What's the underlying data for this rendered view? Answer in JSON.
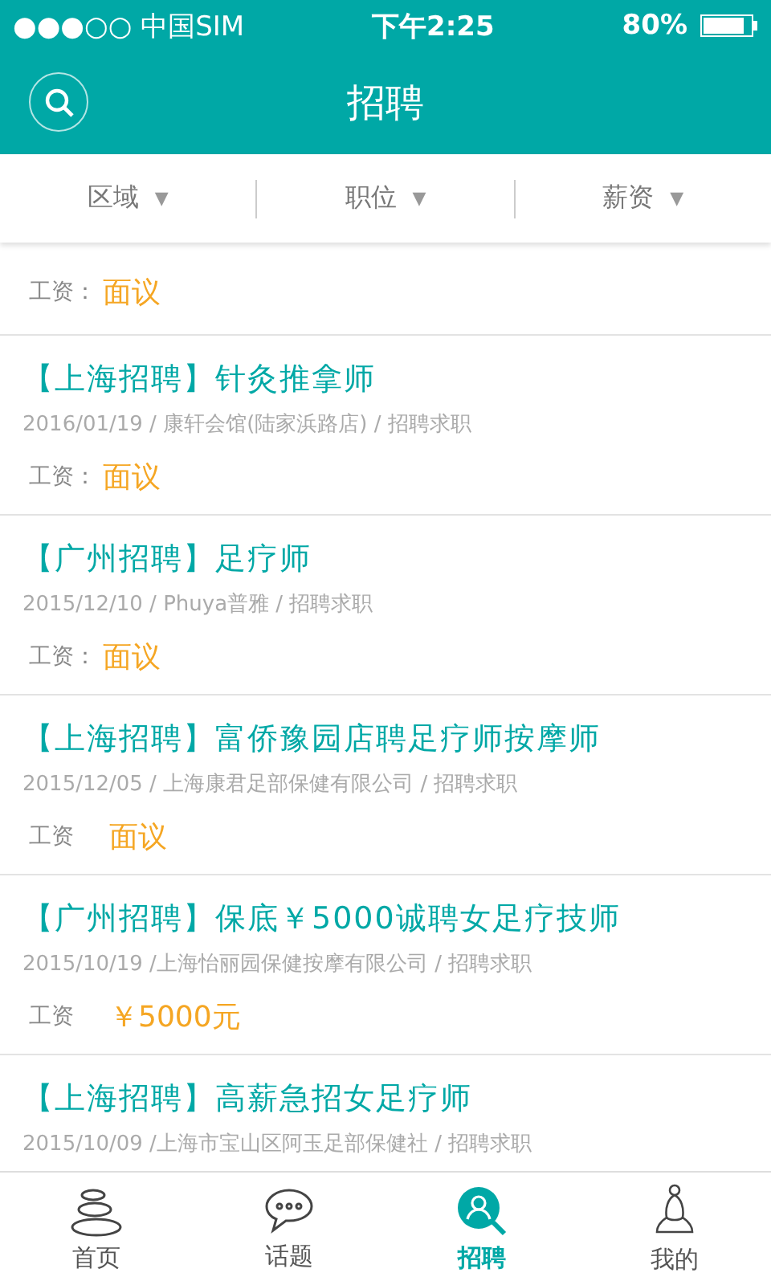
{
  "status_bar": {
    "carrier": "●●●○○ 中国SIM",
    "time": "下午2:25",
    "battery": "80%"
  },
  "header": {
    "title": "招聘"
  },
  "filters": [
    {
      "label": "区域",
      "dropdown": "▼"
    },
    {
      "label": "职位",
      "dropdown": "▼"
    },
    {
      "label": "薪资",
      "dropdown": "▼"
    }
  ],
  "jobs": [
    {
      "salary_label": "工资：",
      "salary": "面议"
    },
    {
      "title": "【上海招聘】针灸推拿师",
      "meta": "2016/01/19 / 康轩会馆(陆家浜路店) / 招聘求职",
      "salary_label": "工资：",
      "salary": "面议"
    },
    {
      "title": "【广州招聘】足疗师",
      "meta": "2015/12/10 / Phuya普雅 / 招聘求职",
      "salary_label": "工资：",
      "salary": "面议"
    },
    {
      "title": "【上海招聘】富侨豫园店聘足疗师按摩师",
      "meta": "2015/12/05 / 上海康君足部保健有限公司 / 招聘求职",
      "salary_label": "工资",
      "salary": "面议"
    },
    {
      "title": "【广州招聘】保底￥5000诚聘女足疗技师",
      "meta": "2015/10/19 /上海怡丽园保健按摩有限公司 / 招聘求职",
      "salary_label": "工资",
      "salary": "￥5000元"
    },
    {
      "title": "【上海招聘】高薪急招女足疗师",
      "meta": "2015/10/09 /上海市宝山区阿玉足部保健社 / 招聘求职"
    }
  ],
  "tab_bar": [
    {
      "label": "首页",
      "kind": "stones",
      "selected": false
    },
    {
      "label": "话题",
      "kind": "chat",
      "selected": false
    },
    {
      "label": "招聘",
      "kind": "search-person",
      "selected": true
    },
    {
      "label": "我的",
      "kind": "meditation",
      "selected": false
    }
  ]
}
